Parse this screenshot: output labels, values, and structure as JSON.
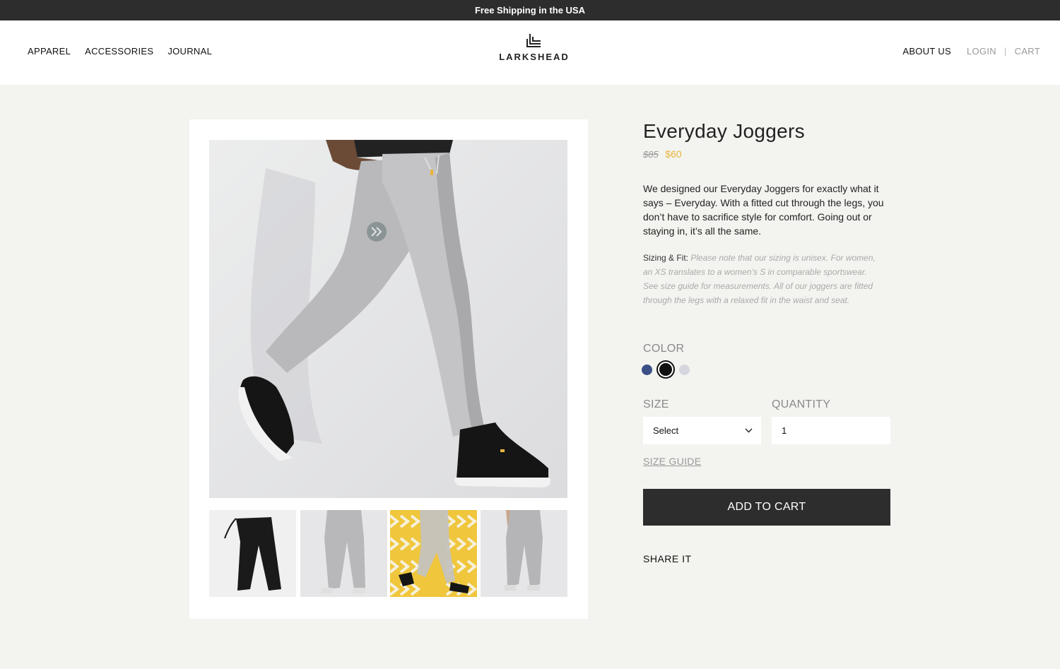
{
  "announcement": "Free Shipping in the USA",
  "nav": {
    "left": [
      "APPAREL",
      "ACCESSORIES",
      "JOURNAL"
    ],
    "about": "ABOUT US",
    "login": "LOGIN",
    "separator": "|",
    "cart": "CART"
  },
  "brand": {
    "name": "LARKSHEAD"
  },
  "product": {
    "title": "Everyday Joggers",
    "price_original": "$85",
    "price_sale": "$60",
    "description": "We designed our Everyday Joggers for exactly what it says – Everyday. With a fitted cut through the legs, you don’t have to sacrifice style for comfort. Going out or staying in, it’s all the same.",
    "sizing_label": "Sizing & Fit:",
    "sizing_text": "Please note that our sizing is unisex. For women, an XS translates to a women’s S in comparable sportswear. See size guide for measurements. All of our joggers are fitted through the legs with a relaxed fit in the waist and seat.",
    "color_label": "COLOR",
    "colors": [
      "#3b4f86",
      "#111111",
      "#d6d6de"
    ],
    "selected_color_index": 1,
    "size_label": "SIZE",
    "size_value": "Select",
    "quantity_label": "QUANTITY",
    "quantity_value": "1",
    "size_guide": "SIZE GUIDE",
    "add_to_cart": "ADD TO CART",
    "share": "SHARE IT"
  },
  "colors": {
    "sale_price": "#e9b53a",
    "button_bg": "#2d2d2d",
    "page_bg": "#f3f4f0"
  }
}
